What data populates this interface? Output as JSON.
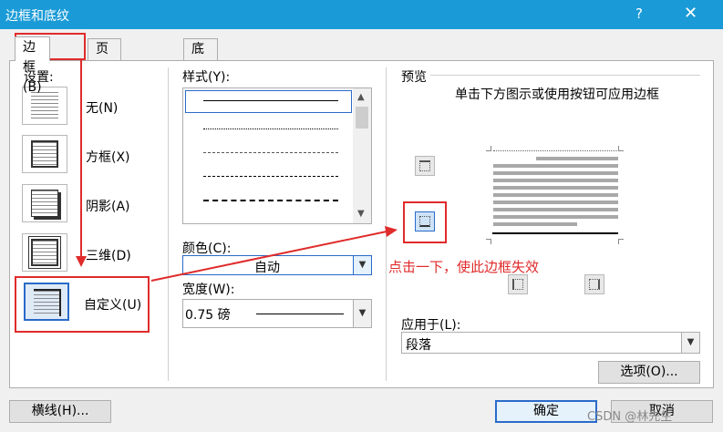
{
  "window": {
    "title": "边框和底纹",
    "help_label": "?",
    "close_label": "✕"
  },
  "tabs": [
    {
      "label": "边框(B)"
    },
    {
      "label": "页面边框(P)"
    },
    {
      "label": "底纹(S)"
    }
  ],
  "settings": {
    "heading": "设置:",
    "items": [
      {
        "label": "无(N)",
        "icon": "none-border-icon"
      },
      {
        "label": "方框(X)",
        "icon": "box-border-icon"
      },
      {
        "label": "阴影(A)",
        "icon": "shadow-border-icon"
      },
      {
        "label": "三维(D)",
        "icon": "3d-border-icon"
      },
      {
        "label": "自定义(U)",
        "icon": "custom-border-icon"
      }
    ]
  },
  "style": {
    "heading": "样式(Y):",
    "color_label": "颜色(C):",
    "color_value": "自动",
    "width_label": "宽度(W):",
    "width_value": "0.75 磅"
  },
  "preview": {
    "heading": "预览",
    "instruction": "单击下方图示或使用按钮可应用边框"
  },
  "apply": {
    "label": "应用于(L):",
    "value": "段落"
  },
  "buttons": {
    "options": "选项(O)...",
    "horizontal_line": "横线(H)...",
    "ok": "确定",
    "cancel": "取消"
  },
  "annotation": {
    "note": "点击一下，使此边框失效"
  },
  "watermark": "CSDN @林先生",
  "colors": {
    "titlebar": "#1a9bd7",
    "annotation": "#e02b2b",
    "selection": "#2a6bc9"
  }
}
